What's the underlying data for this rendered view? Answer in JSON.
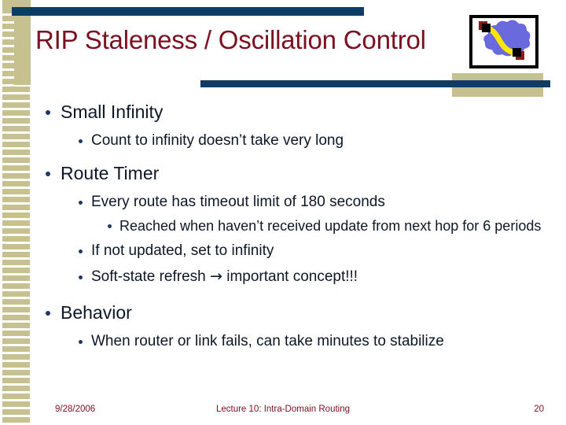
{
  "slide": {
    "title": "RIP Staleness / Oscillation Control",
    "title_color": "#7b1120",
    "accent_bar_color": "#0f3c64",
    "accent_block_color": "#c7c191",
    "body_text_color": "#0d1726",
    "bullet_color": "#1f3864",
    "background": "#ffffff"
  },
  "logo": {
    "name": "network-cloud-diagram",
    "cloud_color": "#6a6ade",
    "link_color": "#ffe800",
    "node_color": "#000000",
    "node_shadow_color": "#8b1a1a",
    "border_color": "#000000"
  },
  "body": {
    "b1": "Small Infinity",
    "b1_1": "Count to infinity doesn’t take very long",
    "b2": "Route Timer",
    "b2_1": "Every route has timeout limit of 180 seconds",
    "b2_1_1": "Reached when haven’t received update from next hop for 6 periods",
    "b2_2": "If not updated, set to infinity",
    "b2_3_pre": "Soft-state refresh ",
    "b2_3_arrow": "→",
    "b2_3_post": " important concept!!!",
    "b3": "Behavior",
    "b3_1": "When router or link fails, can take minutes to stabilize"
  },
  "footer": {
    "date": "9/28/2006",
    "center": "Lecture 10: Intra-Domain Routing",
    "page": "20"
  }
}
